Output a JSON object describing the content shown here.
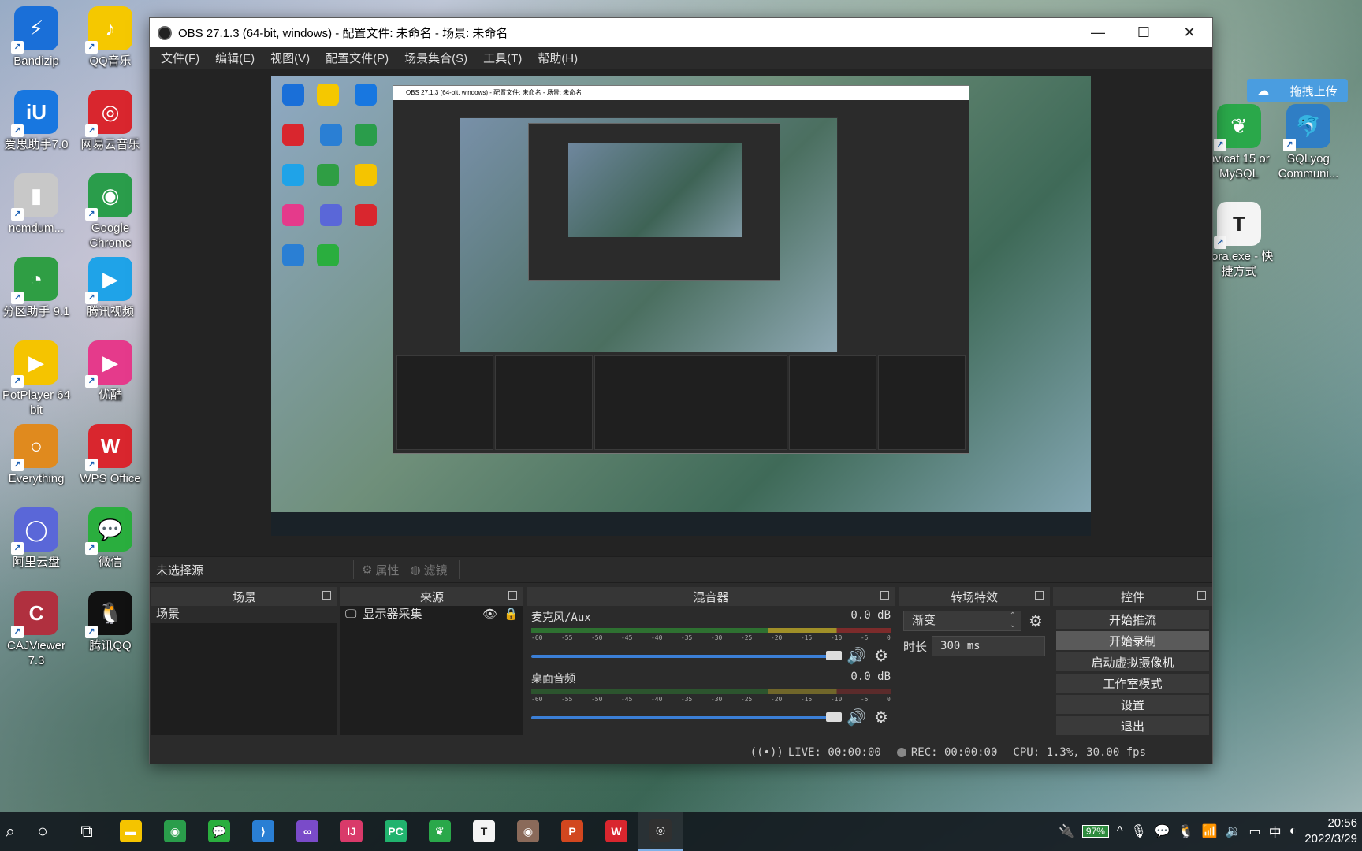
{
  "desktop": {
    "left_icons": [
      {
        "label": "Bandizip",
        "icon": "bandizip-icon",
        "color": "#1a6fd8",
        "glyph": "⚡"
      },
      {
        "label": "QQ音乐",
        "icon": "qq-music-icon",
        "color": "#f5c800",
        "glyph": "♪"
      },
      {
        "label": "爱思助手7.0",
        "icon": "aisi-icon",
        "color": "#1877e0",
        "glyph": "iU"
      },
      {
        "label": "网易云音乐",
        "icon": "netease-music-icon",
        "color": "#d9262e",
        "glyph": "◎"
      },
      {
        "label": "ncmdum...",
        "icon": "ncmdump-icon",
        "color": "#c8c8c8",
        "glyph": "▮"
      },
      {
        "label": "Google Chrome",
        "icon": "chrome-icon",
        "color": "#2a9d4b",
        "glyph": "◉"
      },
      {
        "label": "分区助手 9.1",
        "icon": "partition-icon",
        "color": "#2f9e44",
        "glyph": "◔"
      },
      {
        "label": "腾讯视频",
        "icon": "tencent-video-icon",
        "color": "#1fa3e8",
        "glyph": "▶"
      },
      {
        "label": "PotPlayer 64 bit",
        "icon": "potplayer-icon",
        "color": "#f5c400",
        "glyph": "▶"
      },
      {
        "label": "优酷",
        "icon": "youku-icon",
        "color": "#e53a8b",
        "glyph": "▶"
      },
      {
        "label": "Everything",
        "icon": "everything-icon",
        "color": "#e08a1e",
        "glyph": "○"
      },
      {
        "label": "WPS Office",
        "icon": "wps-icon",
        "color": "#d9262e",
        "glyph": "W"
      },
      {
        "label": "阿里云盘",
        "icon": "aliyun-drive-icon",
        "color": "#5a67d8",
        "glyph": "◯"
      },
      {
        "label": "微信",
        "icon": "wechat-icon",
        "color": "#2aae3e",
        "glyph": "💬"
      },
      {
        "label": "CAJViewer 7.3",
        "icon": "cajviewer-icon",
        "color": "#b0303f",
        "glyph": "C"
      },
      {
        "label": "腾讯QQ",
        "icon": "qq-icon",
        "color": "#111111",
        "glyph": "🐧"
      }
    ],
    "right_icons": [
      {
        "label": "avicat 15 or MySQL",
        "icon": "navicat-icon",
        "color": "#2aa84a",
        "glyph": "❦"
      },
      {
        "label": "SQLyog Communi...",
        "icon": "sqlyog-icon",
        "color": "#2f7ec5",
        "glyph": "🐬"
      },
      {
        "label": "pora.exe - 快捷方式",
        "icon": "typora-icon",
        "color": "#f4f4f4",
        "glyph": "T"
      }
    ],
    "upload_widget": {
      "label": "拖拽上传",
      "icon": "baidu-netdisk-icon"
    }
  },
  "obs": {
    "title": "OBS 27.1.3 (64-bit, windows) - 配置文件: 未命名 - 场景: 未命名",
    "menu": [
      "文件(F)",
      "编辑(E)",
      "视图(V)",
      "配置文件(P)",
      "场景集合(S)",
      "工具(T)",
      "帮助(H)"
    ],
    "source_toolbar": {
      "no_source": "未选择源",
      "properties": "属性",
      "filters": "滤镜"
    },
    "docks": {
      "scenes": {
        "title": "场景",
        "items": [
          "场景"
        ]
      },
      "sources": {
        "title": "来源",
        "items": [
          {
            "label": "显示器采集",
            "icon": "monitor-icon"
          }
        ]
      },
      "mixer": {
        "title": "混音器",
        "tracks": [
          {
            "name": "麦克风/Aux",
            "level": "0.0 dB"
          },
          {
            "name": "桌面音频",
            "level": "0.0 dB"
          }
        ],
        "ticks": [
          "-60",
          "-55",
          "-50",
          "-45",
          "-40",
          "-35",
          "-30",
          "-25",
          "-20",
          "-15",
          "-10",
          "-5",
          "0"
        ]
      },
      "transitions": {
        "title": "转场特效",
        "selected": "渐变",
        "duration_label": "时长",
        "duration_value": "300 ms"
      },
      "controls": {
        "title": "控件",
        "buttons": [
          "开始推流",
          "开始录制",
          "启动虚拟摄像机",
          "工作室模式",
          "设置",
          "退出"
        ]
      }
    },
    "status": {
      "live": "LIVE: 00:00:00",
      "rec": "REC: 00:00:00",
      "cpu": "CPU: 1.3%, 30.00 fps"
    }
  },
  "taskbar": {
    "apps": [
      {
        "name": "file-explorer-icon",
        "color": "#f5c400",
        "glyph": "▬"
      },
      {
        "name": "chrome-icon",
        "color": "#2a9d4b",
        "glyph": "◉"
      },
      {
        "name": "wechat-icon",
        "color": "#2aae3e",
        "glyph": "💬"
      },
      {
        "name": "vscode-icon",
        "color": "#2a7fd4",
        "glyph": "⟩"
      },
      {
        "name": "visual-studio-icon",
        "color": "#7a4bc9",
        "glyph": "∞"
      },
      {
        "name": "intellij-icon",
        "color": "#d93a6a",
        "glyph": "IJ"
      },
      {
        "name": "pycharm-icon",
        "color": "#21b36e",
        "glyph": "PC"
      },
      {
        "name": "navicat-icon",
        "color": "#2aa84a",
        "glyph": "❦"
      },
      {
        "name": "typora-icon",
        "color": "#f4f4f4",
        "glyph": "T"
      },
      {
        "name": "avatar-app-icon",
        "color": "#8a6a5a",
        "glyph": "◉"
      },
      {
        "name": "powerpoint-icon",
        "color": "#d2471f",
        "glyph": "P"
      },
      {
        "name": "wps-icon",
        "color": "#d9262e",
        "glyph": "W"
      },
      {
        "name": "obs-icon",
        "color": "#303030",
        "glyph": "◎"
      }
    ],
    "battery": "97%",
    "ime": "中",
    "time": "20:56",
    "date": "2022/3/29"
  }
}
